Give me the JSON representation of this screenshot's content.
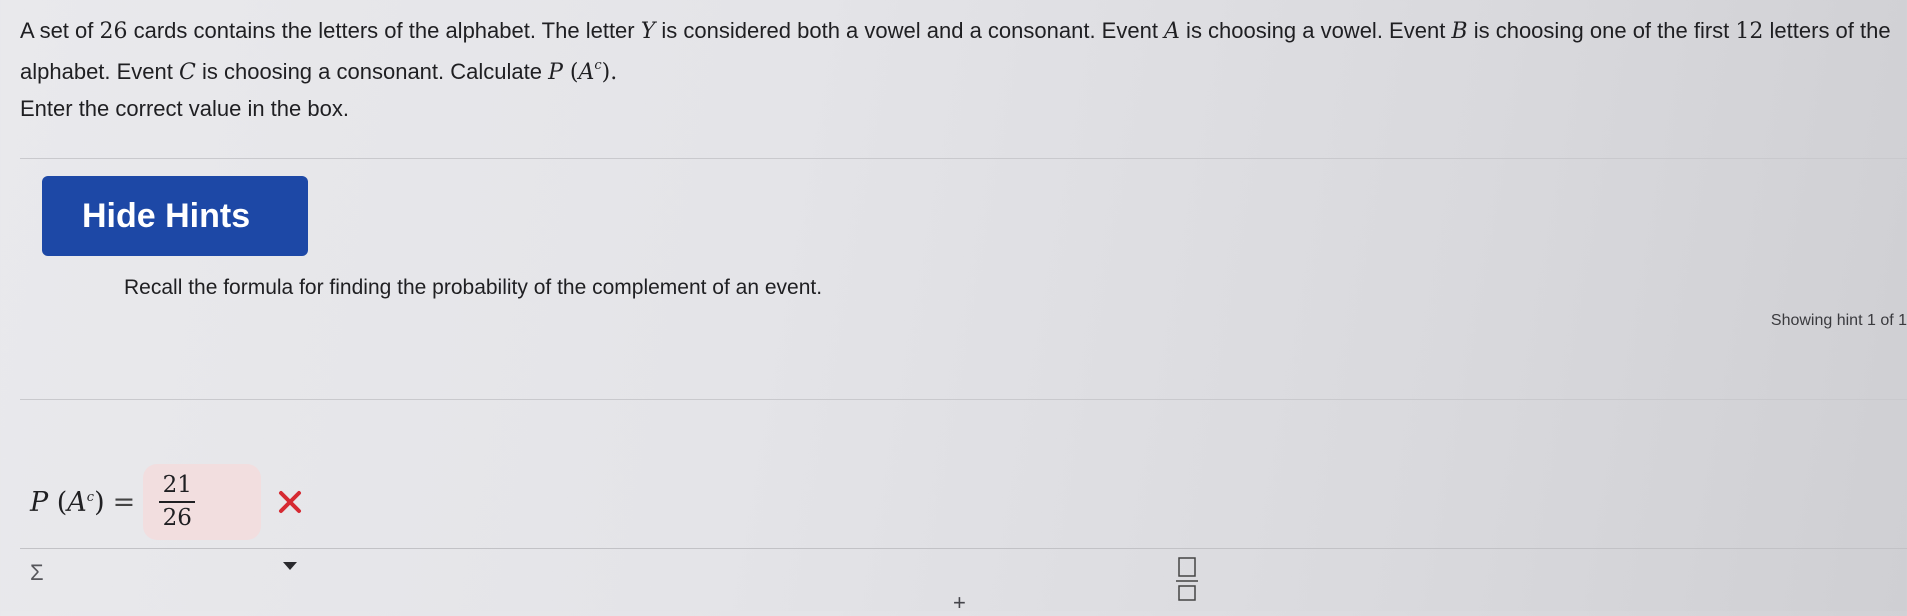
{
  "question": {
    "part1": "A set of ",
    "count": "26",
    "part2": " cards contains the letters of the alphabet. The letter ",
    "letter_y": "Y",
    "part3": " is considered both a vowel and a consonant. Event ",
    "event_a": "A",
    "part4": " is choosing a vowel. Event ",
    "event_b": "B",
    "part5": " is choosing one of the first ",
    "first_n": "12",
    "part6": " letters of the alphabet. Event ",
    "event_c": "C",
    "part7": " is choosing a consonant. Calculate ",
    "calc_p": "P",
    "calc_open": " (",
    "calc_a": "A",
    "calc_sup": "c",
    "calc_close": ").",
    "instruction": "Enter the correct value in the box."
  },
  "hints": {
    "button_label": "Hide Hints",
    "text": "Recall the formula for finding the probability of the complement of an event.",
    "counter": "Showing hint 1 of 1"
  },
  "answer": {
    "label_p": "P",
    "label_open": " (",
    "label_a": "A",
    "label_sup": "c",
    "label_close": ")",
    "equals": "=",
    "numerator": "21",
    "denominator": "26",
    "status": "incorrect",
    "status_color": "#d62a32",
    "box_color": "#f2dedf"
  },
  "toolbar": {
    "sigma_symbol": "Σ",
    "dropdown_icon": "caret-down-icon",
    "plus_symbol": "+",
    "fraction_icon": "fraction-template-icon"
  },
  "colors": {
    "button_bg": "#1d48a6",
    "button_text": "#ffffff"
  }
}
